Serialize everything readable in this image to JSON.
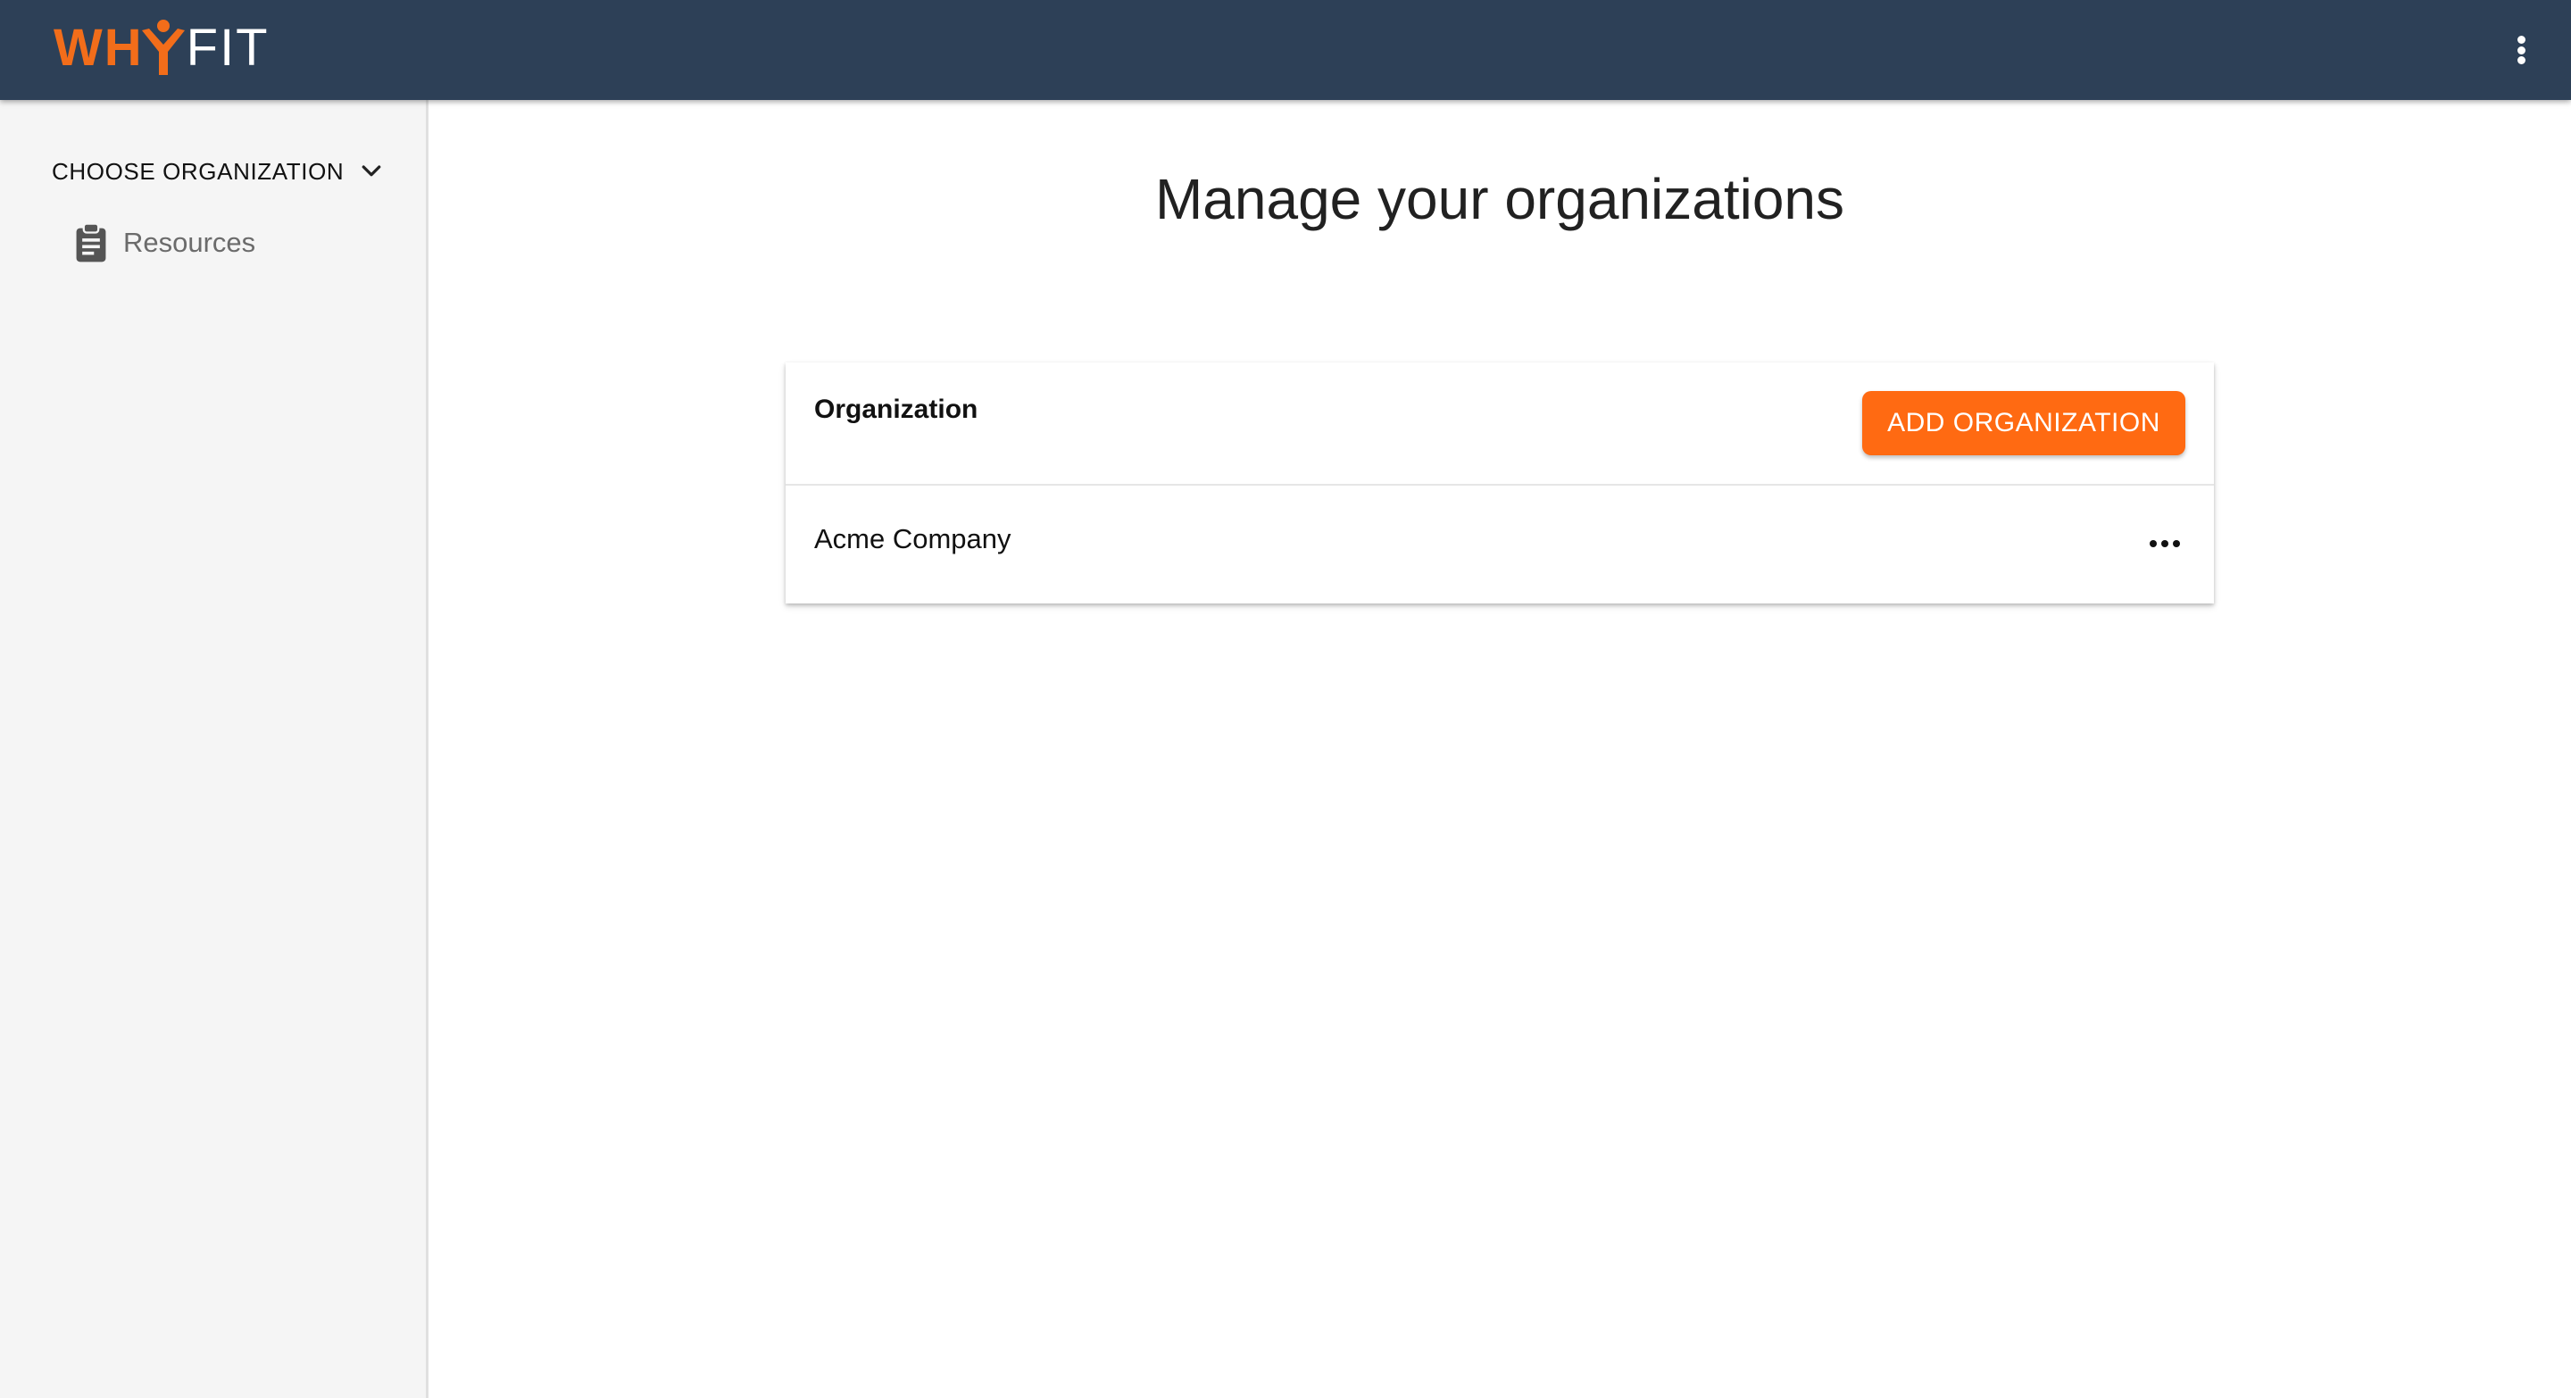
{
  "app": {
    "logo_why": "WH",
    "logo_fit": "FIT",
    "brand_color": "#f26d1a",
    "header_color": "#2d4057"
  },
  "header": {
    "menu_icon": "more-vert-icon"
  },
  "sidebar": {
    "org_chooser_label": "CHOOSE ORGANIZATION",
    "org_chooser_icon": "chevron-down-icon",
    "items": [
      {
        "label": "Resources",
        "icon": "clipboard-icon"
      }
    ]
  },
  "main": {
    "title": "Manage your organizations",
    "table": {
      "header_label": "Organization",
      "add_button_label": "ADD ORGANIZATION",
      "rows": [
        {
          "name": "Acme Company",
          "action_icon": "more-horiz-icon"
        }
      ]
    }
  }
}
